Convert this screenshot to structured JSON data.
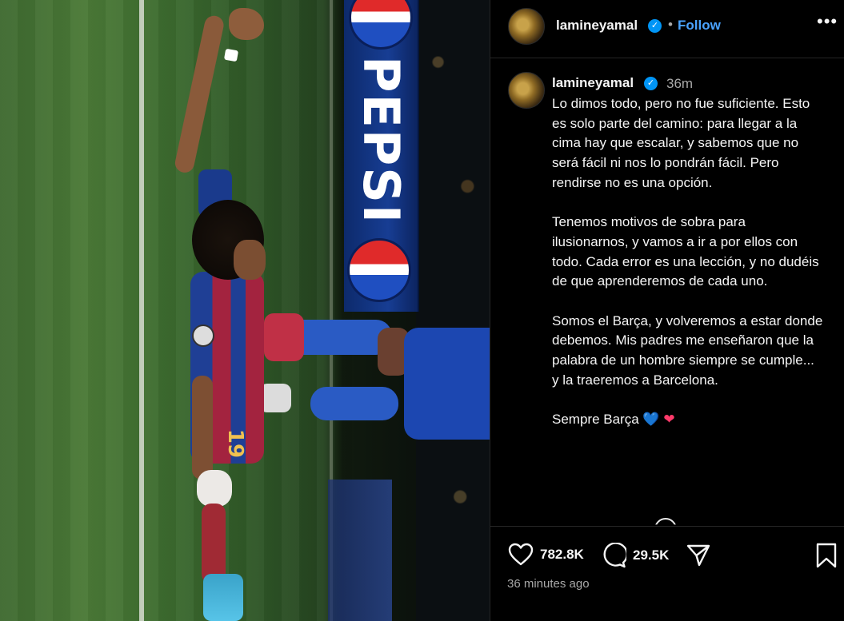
{
  "post": {
    "username": "lamineyamal",
    "follow_label": "Follow",
    "separator": "•",
    "more_label": "•••",
    "verified_mark": "✓",
    "time_short": "36m",
    "time_long": "36 minutes ago",
    "caption": [
      "Lo dimos todo, pero no fue suficiente. Esto es solo parte del camino: para llegar a la cima hay que escalar, y sabemos que no será fácil ni nos lo pondrán fácil. Pero rendirse no es una opción.",
      "Tenemos motivos de sobra para ilusionarnos, y vamos a ir a por ellos con todo. Cada error es una lección, y no dudéis de que aprenderemos de cada uno.",
      "Somos el Barça, y volveremos a estar donde debemos. Mis padres me enseñaron que la palabra de un hombre siempre se cumple... y la traeremos a Barcelona."
    ],
    "closing_text": "Sempre Barça",
    "closing_emojis": [
      "💙",
      "❤"
    ],
    "likes": "782.8K",
    "comments": "29.5K"
  },
  "photo": {
    "ad_text": "PEPSI",
    "jersey_number": "19"
  },
  "icons": {
    "like": "heart-outline-icon",
    "comment": "speech-bubble-icon",
    "share": "paper-plane-icon",
    "save": "bookmark-icon",
    "more": "more-horizontal-icon",
    "verified": "verified-badge-icon"
  },
  "colors": {
    "background": "#000000",
    "text": "#f5f5f5",
    "muted": "#a8a8a8",
    "link": "#4aa3ff",
    "verified": "#0095f6",
    "divider": "#262626"
  }
}
